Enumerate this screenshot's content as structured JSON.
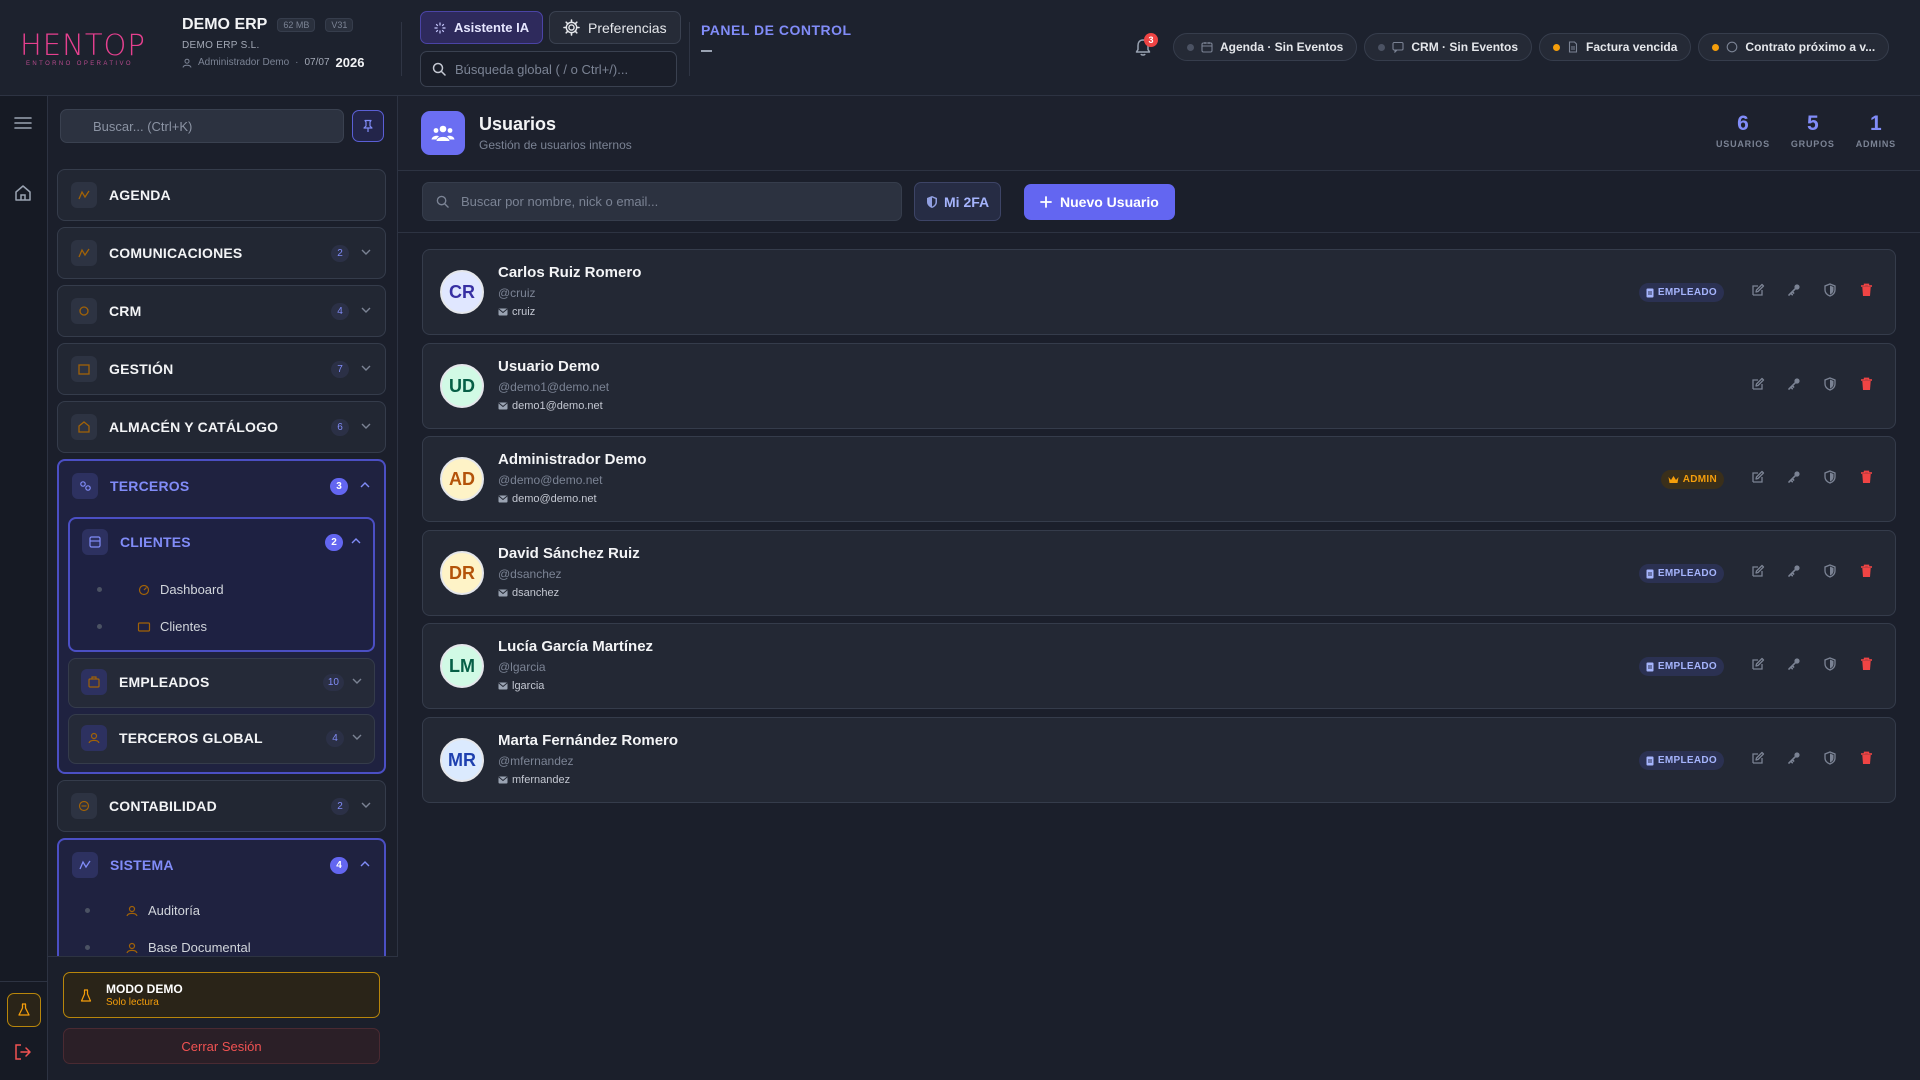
{
  "brand": {
    "logo_text": "HENTOP",
    "logo_sub": "ENTORNO OPERATIVO"
  },
  "company": {
    "name": "DEMO ERP",
    "size_tag": "62 MB",
    "version_tag": "V31",
    "legal_name": "DEMO ERP S.L.",
    "user": "Administrador Demo",
    "date": "07/07",
    "year": "2026"
  },
  "header": {
    "ai_button": "Asistente IA",
    "prefs_button": "Preferencias",
    "search_placeholder": "Búsqueda global ( / o Ctrl+/)...",
    "panel_title": "PANEL DE CONTROL",
    "notifications_count": "3",
    "pills": [
      {
        "label": "Agenda · Sin Eventos",
        "dot": "#4b5263"
      },
      {
        "label": "CRM · Sin Eventos",
        "dot": "#4b5263"
      },
      {
        "label": "Factura vencida",
        "dot": "#f59e0b"
      },
      {
        "label": "Contrato próximo a v...",
        "dot": "#f59e0b"
      }
    ]
  },
  "sidebar": {
    "search_placeholder": "Buscar... (Ctrl+K)",
    "sections": [
      {
        "label": "AGENDA"
      },
      {
        "label": "COMUNICACIONES",
        "count": "2"
      },
      {
        "label": "CRM",
        "count": "4"
      },
      {
        "label": "GESTIÓN",
        "count": "7"
      },
      {
        "label": "ALMACÉN Y CATÁLOGO",
        "count": "6"
      },
      {
        "label": "TERCEROS",
        "count": "3"
      },
      {
        "label": "CONTABILIDAD",
        "count": "2"
      },
      {
        "label": "SISTEMA",
        "count": "4"
      }
    ],
    "terceros_sub": [
      {
        "label": "CLIENTES",
        "count": "2",
        "items": [
          "Dashboard",
          "Clientes"
        ]
      },
      {
        "label": "EMPLEADOS",
        "count": "10"
      },
      {
        "label": "TERCEROS GLOBAL",
        "count": "4"
      }
    ],
    "sistema_items": [
      "Auditoría",
      "Base Documental"
    ],
    "demo_title": "MODO DEMO",
    "demo_sub": "Solo lectura",
    "logout": "Cerrar Sesión"
  },
  "page": {
    "title": "Usuarios",
    "subtitle": "Gestión de usuarios internos",
    "stats": [
      {
        "value": "6",
        "label": "USUARIOS"
      },
      {
        "value": "5",
        "label": "GRUPOS"
      },
      {
        "value": "1",
        "label": "ADMINS"
      }
    ],
    "search_placeholder": "Buscar por nombre, nick o email...",
    "twofa_button": "Mi 2FA",
    "new_user_button": "Nuevo Usuario"
  },
  "users": [
    {
      "initials": "CR",
      "name": "Carlos Ruiz Romero",
      "nick": "@cruiz",
      "email": "cruiz",
      "role": "EMPLEADO",
      "avatar_bg": "#e0e7ff",
      "avatar_fg": "#3730a3"
    },
    {
      "initials": "UD",
      "name": "Usuario Demo",
      "nick": "@demo1@demo.net",
      "email": "demo1@demo.net",
      "role": "",
      "avatar_bg": "#d1fae5",
      "avatar_fg": "#065f46"
    },
    {
      "initials": "AD",
      "name": "Administrador Demo",
      "nick": "@demo@demo.net",
      "email": "demo@demo.net",
      "role": "ADMIN",
      "avatar_bg": "#fef3c7",
      "avatar_fg": "#b45309"
    },
    {
      "initials": "DR",
      "name": "David Sánchez Ruiz",
      "nick": "@dsanchez",
      "email": "dsanchez",
      "role": "EMPLEADO",
      "avatar_bg": "#fef3c7",
      "avatar_fg": "#b45309"
    },
    {
      "initials": "LM",
      "name": "Lucía García Martínez",
      "nick": "@lgarcia",
      "email": "lgarcia",
      "role": "EMPLEADO",
      "avatar_bg": "#d1fae5",
      "avatar_fg": "#065f46"
    },
    {
      "initials": "MR",
      "name": "Marta Fernández Romero",
      "nick": "@mfernandez",
      "email": "mfernandez",
      "role": "EMPLEADO",
      "avatar_bg": "#dbeafe",
      "avatar_fg": "#1e40af"
    }
  ]
}
